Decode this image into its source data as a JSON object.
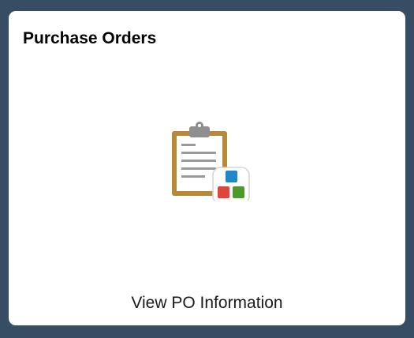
{
  "tile": {
    "title": "Purchase Orders",
    "icon": "clipboard-with-app-grid-icon",
    "footer_label": "View PO Information"
  },
  "colors": {
    "background": "#364d63",
    "tile": "#ffffff",
    "clipboard": "#b8893a",
    "app_blue": "#1e88c9",
    "app_red": "#e0453a",
    "app_green": "#4c9a2a"
  }
}
